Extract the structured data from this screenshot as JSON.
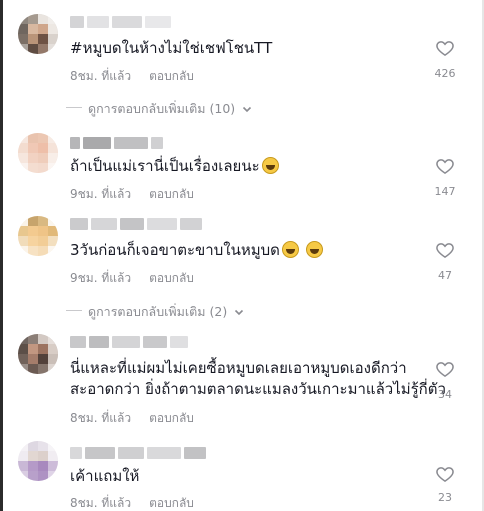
{
  "comments": [
    {
      "text": "#หมูบดในห้างไม่ใช่เชฟโชนTT",
      "time": "8ชม. ที่แล้ว",
      "reply_label": "ตอบกลับ",
      "likes": "426",
      "more_replies": "ดูการตอบกลับเพิ่มเติม (10)"
    },
    {
      "text": "ถ้าเป็นแม่เรานี่เป็นเรื่องเลยนะ",
      "emoji_count": 1,
      "time": "9ชม. ที่แล้ว",
      "reply_label": "ตอบกลับ",
      "likes": "147"
    },
    {
      "text": "3วันก่อนก็เจอขาตะขาบในหมูบด",
      "emoji_count": 2,
      "time": "9ชม. ที่แล้ว",
      "reply_label": "ตอบกลับ",
      "likes": "47",
      "more_replies": "ดูการตอบกลับเพิ่มเติม (2)"
    },
    {
      "text_line1": "นี่แหละที่แม่ผมไม่เคยซื้อหมูบดเลยเอาหมูบดเองดีกว่า",
      "text_line2": "สะอาดกว่า ยิ่งถ้าตามตลาดนะแมลงวันเกาะมาแล้วไม่รู้กี่ตัว",
      "time": "8ชม. ที่แล้ว",
      "reply_label": "ตอบกลับ",
      "likes": "34"
    },
    {
      "text": "เค้าแถมให้",
      "time": "8ชม. ที่แล้ว",
      "reply_label": "ตอบกลับ",
      "likes": "23"
    }
  ],
  "colors": {
    "text": "#161823",
    "muted": "#8a8b91",
    "emoji": "#f6c945"
  },
  "icons": {
    "like": "heart-outline-icon",
    "expand": "chevron-down-icon",
    "emoji": "grinning-squinting-face-emoji"
  }
}
